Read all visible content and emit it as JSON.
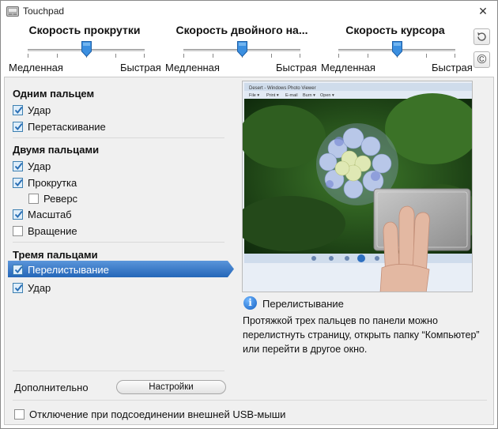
{
  "window": {
    "title": "Touchpad",
    "close_glyph": "✕"
  },
  "sliders": [
    {
      "title": "Скорость прокрутки",
      "min_label": "Медленная",
      "max_label": "Быстрая",
      "value": 0.5
    },
    {
      "title": "Скорость двойного на...",
      "min_label": "Медленная",
      "max_label": "Быстрая",
      "value": 0.5
    },
    {
      "title": "Скорость курсора",
      "min_label": "Медленная",
      "max_label": "Быстрая",
      "value": 0.5
    }
  ],
  "side_buttons": {
    "reset_icon": "reset-icon",
    "copyright_icon": "copyright-icon",
    "copyright_glyph": "©"
  },
  "sections": {
    "one_finger": {
      "heading": "Одним пальцем",
      "items": [
        {
          "label": "Удар",
          "checked": true
        },
        {
          "label": "Перетаскивание",
          "checked": true
        }
      ]
    },
    "two_fingers": {
      "heading": "Двумя пальцами",
      "items": [
        {
          "label": "Удар",
          "checked": true
        },
        {
          "label": "Прокрутка",
          "checked": true
        },
        {
          "label": "Реверс",
          "checked": false
        },
        {
          "label": "Масштаб",
          "checked": true
        },
        {
          "label": "Вращение",
          "checked": false
        }
      ]
    },
    "three_fingers": {
      "heading": "Тремя пальцами",
      "items": [
        {
          "label": "Перелистывание",
          "checked": true,
          "selected": true
        },
        {
          "label": "Удар",
          "checked": true
        }
      ]
    }
  },
  "preview": {
    "window_title": "Desert - Windows Photo Viewer",
    "menu": [
      "File ▾",
      "Print ▾",
      "E-mail",
      "Burn ▾",
      "Open ▾"
    ]
  },
  "info": {
    "title": "Перелистывание",
    "description": "Протяжкой трех пальцев по панели можно перелистнуть страницу, открыть папку “Компьютер” или перейти в другое окно."
  },
  "advanced": {
    "label": "Дополнительно",
    "button_label": "Настройки"
  },
  "usb_option": {
    "label": "Отключение при подсоединении внешней USB-мыши",
    "checked": false
  },
  "colors": {
    "selection": "#2f6fbf",
    "check": "#2a6fb5"
  }
}
